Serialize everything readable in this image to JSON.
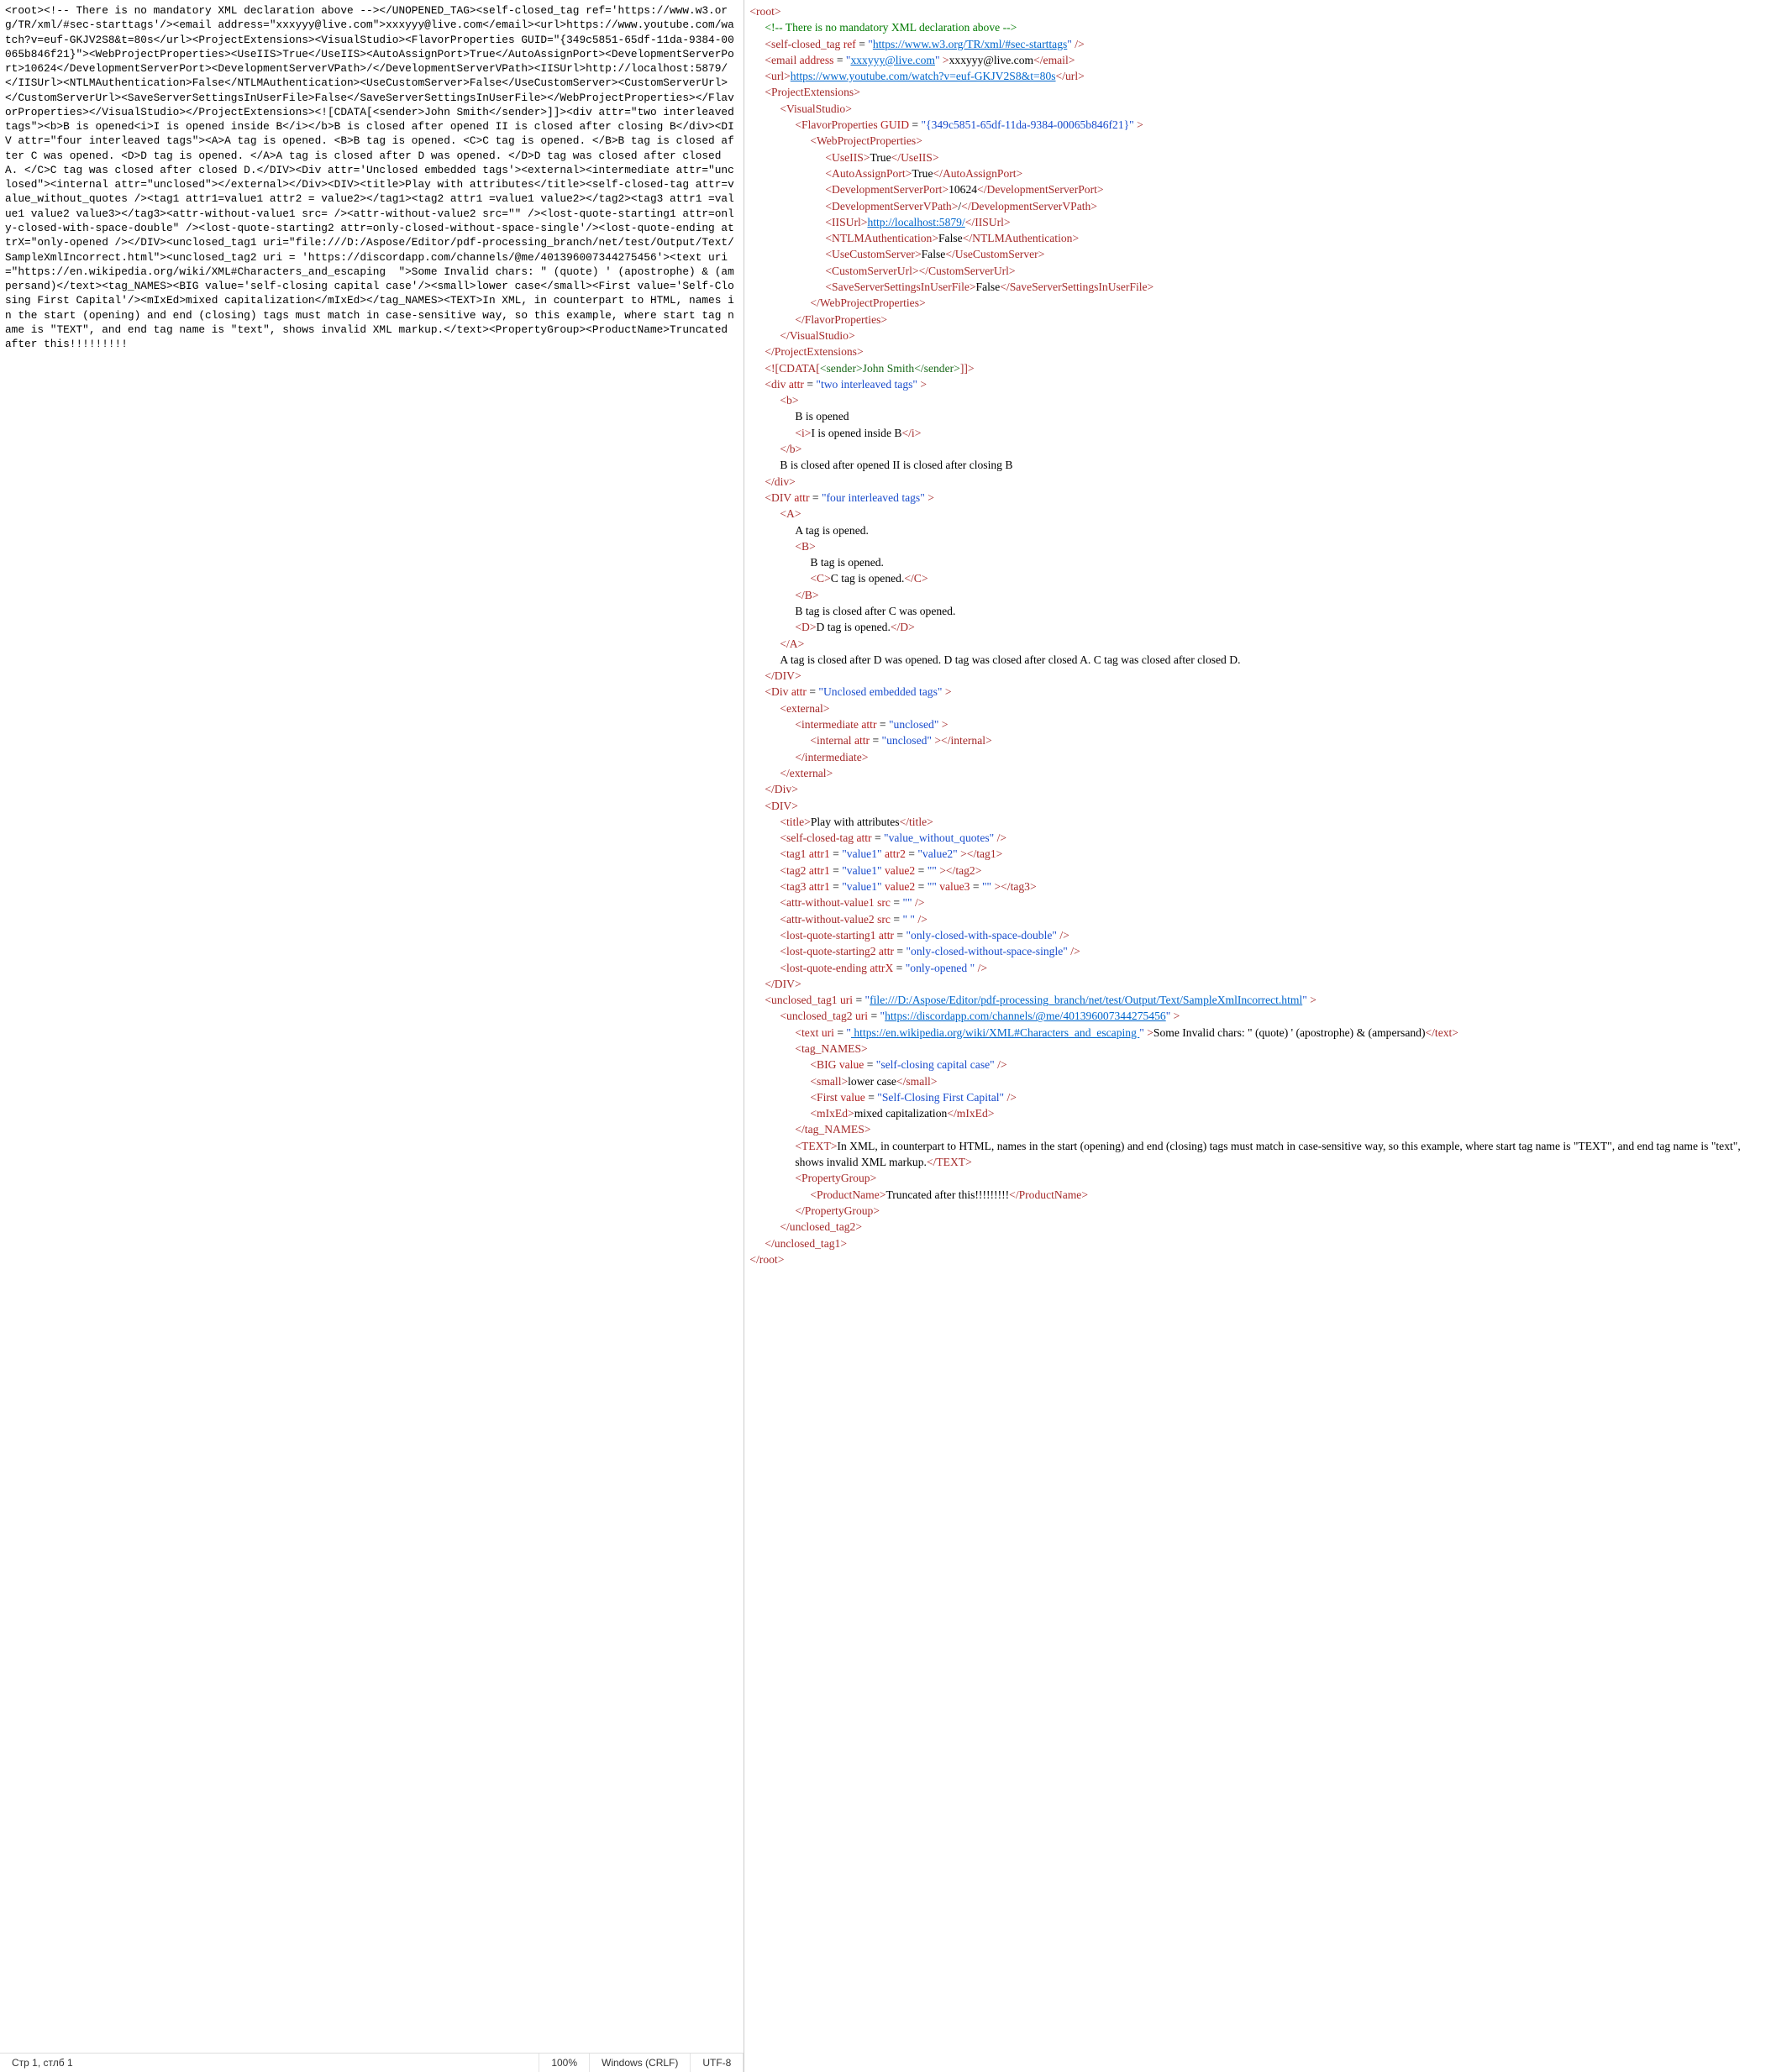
{
  "status": {
    "pos": "Стр 1, стлб 1",
    "zoom": "100%",
    "eol": "Windows (CRLF)",
    "encoding": "UTF-8"
  },
  "raw_left": "<root><!-- There is no mandatory XML declaration above --></UNOPENED_TAG><self-closed_tag ref='https://www.w3.org/TR/xml/#sec-starttags'/><email address=\"xxxyyy@live.com\">xxxyyy@live.com</email><url>https://www.youtube.com/watch?v=euf-GKJV2S8&t=80s</url><ProjectExtensions><VisualStudio><FlavorProperties GUID=\"{349c5851-65df-11da-9384-00065b846f21}\"><WebProjectProperties><UseIIS>True</UseIIS><AutoAssignPort>True</AutoAssignPort><DevelopmentServerPort>10624</DevelopmentServerPort><DevelopmentServerVPath>/</DevelopmentServerVPath><IISUrl>http://localhost:5879/</IISUrl><NTLMAuthentication>False</NTLMAuthentication><UseCustomServer>False</UseCustomServer><CustomServerUrl></CustomServerUrl><SaveServerSettingsInUserFile>False</SaveServerSettingsInUserFile></WebProjectProperties></FlavorProperties></VisualStudio></ProjectExtensions><![CDATA[<sender>John Smith</sender>]]><div attr=\"two interleaved tags\"><b>B is opened<i>I is opened inside B</i></b>B is closed after opened II is closed after closing B</div><DIV attr=\"four interleaved tags\"><A>A tag is opened. <B>B tag is opened. <C>C tag is opened. </B>B tag is closed after C was opened. <D>D tag is opened. </A>A tag is closed after D was opened. </D>D tag was closed after closed A. </C>C tag was closed after closed D.</DIV><Div attr='Unclosed embedded tags'><external><intermediate attr=\"unclosed\"><internal attr=\"unclosed\"></external></Div><DIV><title>Play with attributes</title><self-closed-tag attr=value_without_quotes /><tag1 attr1=value1 attr2 = value2></tag1><tag2 attr1 =value1 value2></tag2><tag3 attr1 =value1 value2 value3></tag3><attr-without-value1 src= /><attr-without-value2 src=\"\" /><lost-quote-starting1 attr=only-closed-with-space-double\" /><lost-quote-starting2 attr=only-closed-without-space-single'/><lost-quote-ending attrX=\"only-opened /></DIV><unclosed_tag1 uri=\"file:///D:/Aspose/Editor/pdf-processing_branch/net/test/Output/Text/SampleXmlIncorrect.html\"><unclosed_tag2 uri = 'https://discordapp.com/channels/@me/401396007344275456'><text uri=\"https://en.wikipedia.org/wiki/XML#Characters_and_escaping  \">Some Invalid chars: \" (quote) ' (apostrophe) & (ampersand)</text><tag_NAMES><BIG value='self-closing capital case'/><small>lower case</small><First value='Self-Closing First Capital'/><mIxEd>mixed capitalization</mIxEd></tag_NAMES><TEXT>In XML, in counterpart to HTML, names in the start (opening) and end (closing) tags must match in case-sensitive way, so this example, where start tag name is \"TEXT\", and end tag name is \"text\", shows invalid XML markup.</text><PropertyGroup><ProductName>Truncated after this!!!!!!!!!",
  "tree": [
    {
      "i": 0,
      "h": "<span class='t'>&lt;root&gt;</span>"
    },
    {
      "i": 1,
      "h": "<span class='cm'>&lt;!-- There is no mandatory XML declaration above --&gt;</span>"
    },
    {
      "i": 1,
      "h": "<span class='t'>&lt;self-closed_tag</span> <span class='an'>ref</span> = <span class='av'>\"<span class='lk'>https://www.w3.org/TR/xml/#sec-starttags</span>\"</span> <span class='t'>/&gt;</span>"
    },
    {
      "i": 1,
      "h": "<span class='t'>&lt;email</span> <span class='an'>address</span> = <span class='av'>\"<span class='lk'>xxxyyy@live.com</span>\"</span> <span class='t'>&gt;</span><span class='tx'>xxxyyy@live.com</span><span class='t'>&lt;/email&gt;</span>"
    },
    {
      "i": 1,
      "h": "<span class='t'>&lt;url&gt;</span><span class='lk'>https://www.youtube.com/watch?v=euf-GKJV2S8&amp;t=80s</span><span class='t'>&lt;/url&gt;</span>"
    },
    {
      "i": 1,
      "h": "<span class='t'>&lt;ProjectExtensions&gt;</span>"
    },
    {
      "i": 2,
      "h": "<span class='t'>&lt;VisualStudio&gt;</span>"
    },
    {
      "i": 3,
      "h": "<span class='t'>&lt;FlavorProperties</span> <span class='an'>GUID</span> = <span class='av'>\"{349c5851-65df-11da-9384-00065b846f21}\"</span> <span class='t'>&gt;</span>"
    },
    {
      "i": 4,
      "h": "<span class='t'>&lt;WebProjectProperties&gt;</span>"
    },
    {
      "i": 5,
      "h": "<span class='t'>&lt;UseIIS&gt;</span><span class='tx'>True</span><span class='t'>&lt;/UseIIS&gt;</span>"
    },
    {
      "i": 5,
      "h": "<span class='t'>&lt;AutoAssignPort&gt;</span><span class='tx'>True</span><span class='t'>&lt;/AutoAssignPort&gt;</span>"
    },
    {
      "i": 5,
      "h": "<span class='t'>&lt;DevelopmentServerPort&gt;</span><span class='tx'>10624</span><span class='t'>&lt;/DevelopmentServerPort&gt;</span>"
    },
    {
      "i": 5,
      "h": "<span class='t'>&lt;DevelopmentServerVPath&gt;</span><span class='tx'>/</span><span class='t'>&lt;/DevelopmentServerVPath&gt;</span>"
    },
    {
      "i": 5,
      "h": "<span class='t'>&lt;IISUrl&gt;</span><span class='lk'>http://localhost:5879/</span><span class='t'>&lt;/IISUrl&gt;</span>"
    },
    {
      "i": 5,
      "h": "<span class='t'>&lt;NTLMAuthentication&gt;</span><span class='tx'>False</span><span class='t'>&lt;/NTLMAuthentication&gt;</span>"
    },
    {
      "i": 5,
      "h": "<span class='t'>&lt;UseCustomServer&gt;</span><span class='tx'>False</span><span class='t'>&lt;/UseCustomServer&gt;</span>"
    },
    {
      "i": 5,
      "h": "<span class='t'>&lt;CustomServerUrl&gt;&lt;/CustomServerUrl&gt;</span>"
    },
    {
      "i": 5,
      "h": "<span class='t'>&lt;SaveServerSettingsInUserFile&gt;</span><span class='tx'>False</span><span class='t'>&lt;/SaveServerSettingsInUserFile&gt;</span>"
    },
    {
      "i": 4,
      "h": "<span class='t'>&lt;/WebProjectProperties&gt;</span>"
    },
    {
      "i": 3,
      "h": "<span class='t'>&lt;/FlavorProperties&gt;</span>"
    },
    {
      "i": 2,
      "h": "<span class='t'>&lt;/VisualStudio&gt;</span>"
    },
    {
      "i": 1,
      "h": "<span class='t'>&lt;/ProjectExtensions&gt;</span>"
    },
    {
      "i": 1,
      "h": "<span class='t'>&lt;![CDATA[</span><span class='cd'>&lt;sender&gt;John Smith&lt;/sender&gt;</span><span class='t'>]]&gt;</span>"
    },
    {
      "i": 1,
      "h": "<span class='t'>&lt;div</span> <span class='an'>attr</span> = <span class='av'>\"two interleaved tags\"</span> <span class='t'>&gt;</span>"
    },
    {
      "i": 2,
      "h": "<span class='t'>&lt;b&gt;</span>"
    },
    {
      "i": 3,
      "h": "<span class='tx'>B is opened</span>"
    },
    {
      "i": 3,
      "h": "<span class='t'>&lt;i&gt;</span><span class='tx'>I is opened inside B</span><span class='t'>&lt;/i&gt;</span>"
    },
    {
      "i": 2,
      "h": "<span class='t'>&lt;/b&gt;</span>"
    },
    {
      "i": 2,
      "h": "<span class='tx'>B is closed after opened II is closed after closing B</span>"
    },
    {
      "i": 1,
      "h": "<span class='t'>&lt;/div&gt;</span>"
    },
    {
      "i": 1,
      "h": "<span class='t'>&lt;DIV</span> <span class='an'>attr</span> = <span class='av'>\"four interleaved tags\"</span> <span class='t'>&gt;</span>"
    },
    {
      "i": 2,
      "h": "<span class='t'>&lt;A&gt;</span>"
    },
    {
      "i": 3,
      "h": "<span class='tx'>A tag is opened.</span>"
    },
    {
      "i": 3,
      "h": "<span class='t'>&lt;B&gt;</span>"
    },
    {
      "i": 4,
      "h": "<span class='tx'>B tag is opened.</span>"
    },
    {
      "i": 4,
      "h": "<span class='t'>&lt;C&gt;</span><span class='tx'>C tag is opened.</span><span class='t'>&lt;/C&gt;</span>"
    },
    {
      "i": 3,
      "h": "<span class='t'>&lt;/B&gt;</span>"
    },
    {
      "i": 3,
      "h": "<span class='tx'>B tag is closed after C was opened.</span>"
    },
    {
      "i": 3,
      "h": "<span class='t'>&lt;D&gt;</span><span class='tx'>D tag is opened.</span><span class='t'>&lt;/D&gt;</span>"
    },
    {
      "i": 2,
      "h": "<span class='t'>&lt;/A&gt;</span>"
    },
    {
      "i": 2,
      "h": "<span class='tx'>A tag is closed after D was opened. D tag was closed after closed A. C tag was closed after closed D.</span>"
    },
    {
      "i": 1,
      "h": "<span class='t'>&lt;/DIV&gt;</span>"
    },
    {
      "i": 1,
      "h": "<span class='t'>&lt;Div</span> <span class='an'>attr</span> = <span class='av'>\"Unclosed embedded tags\"</span> <span class='t'>&gt;</span>"
    },
    {
      "i": 2,
      "h": "<span class='t'>&lt;external&gt;</span>"
    },
    {
      "i": 3,
      "h": "<span class='t'>&lt;intermediate</span> <span class='an'>attr</span> = <span class='av'>\"unclosed\"</span> <span class='t'>&gt;</span>"
    },
    {
      "i": 4,
      "h": "<span class='t'>&lt;internal</span> <span class='an'>attr</span> = <span class='av'>\"unclosed\"</span> <span class='t'>&gt;&lt;/internal&gt;</span>"
    },
    {
      "i": 3,
      "h": "<span class='t'>&lt;/intermediate&gt;</span>"
    },
    {
      "i": 2,
      "h": "<span class='t'>&lt;/external&gt;</span>"
    },
    {
      "i": 1,
      "h": "<span class='t'>&lt;/Div&gt;</span>"
    },
    {
      "i": 1,
      "h": "<span class='t'>&lt;DIV&gt;</span>"
    },
    {
      "i": 2,
      "h": "<span class='t'>&lt;title&gt;</span><span class='tx'>Play with attributes</span><span class='t'>&lt;/title&gt;</span>"
    },
    {
      "i": 2,
      "h": "<span class='t'>&lt;self-closed-tag</span> <span class='an'>attr</span> = <span class='av'>\"value_without_quotes\"</span> <span class='t'>/&gt;</span>"
    },
    {
      "i": 2,
      "h": "<span class='t'>&lt;tag1</span> <span class='an'>attr1</span> = <span class='av'>\"value1\"</span> <span class='an'>attr2</span> = <span class='av'>\"value2\"</span> <span class='t'>&gt;&lt;/tag1&gt;</span>"
    },
    {
      "i": 2,
      "h": "<span class='t'>&lt;tag2</span> <span class='an'>attr1</span> = <span class='av'>\"value1\"</span> <span class='an'>value2</span> = <span class='av'>\"\"</span> <span class='t'>&gt;&lt;/tag2&gt;</span>"
    },
    {
      "i": 2,
      "h": "<span class='t'>&lt;tag3</span> <span class='an'>attr1</span> = <span class='av'>\"value1\"</span> <span class='an'>value2</span> = <span class='av'>\"\"</span> <span class='an'>value3</span> = <span class='av'>\"\"</span> <span class='t'>&gt;&lt;/tag3&gt;</span>"
    },
    {
      "i": 2,
      "h": "<span class='t'>&lt;attr-without-value1</span> <span class='an'>src</span> = <span class='av'>\"\"</span> <span class='t'>/&gt;</span>"
    },
    {
      "i": 2,
      "h": "<span class='t'>&lt;attr-without-value2</span> <span class='an'>src</span> = <span class='av'>\" \"</span> <span class='t'>/&gt;</span>"
    },
    {
      "i": 2,
      "h": "<span class='t'>&lt;lost-quote-starting1</span> <span class='an'>attr</span> = <span class='av'>\"only-closed-with-space-double\"</span> <span class='t'>/&gt;</span>"
    },
    {
      "i": 2,
      "h": "<span class='t'>&lt;lost-quote-starting2</span> <span class='an'>attr</span> = <span class='av'>\"only-closed-without-space-single\"</span> <span class='t'>/&gt;</span>"
    },
    {
      "i": 2,
      "h": "<span class='t'>&lt;lost-quote-ending</span> <span class='an'>attrX</span> = <span class='av'>\"only-opened \"</span> <span class='t'>/&gt;</span>"
    },
    {
      "i": 1,
      "h": "<span class='t'>&lt;/DIV&gt;</span>"
    },
    {
      "i": 1,
      "h": "<span class='t'>&lt;unclosed_tag1</span> <span class='an'>uri</span> = <span class='av'>\"<span class='lk'>file:///D:/Aspose/Editor/pdf-processing_branch/net/test/Output/Text/SampleXmlIncorrect.html</span>\"</span> <span class='t'>&gt;</span>"
    },
    {
      "i": 2,
      "h": "<span class='t'>&lt;unclosed_tag2</span> <span class='an'>uri</span> = <span class='av'>\"<span class='lk'>https://discordapp.com/channels/@me/401396007344275456</span>\"</span> <span class='t'>&gt;</span>"
    },
    {
      "i": 3,
      "h": "<span class='t'>&lt;text</span> <span class='an'>uri</span> = <span class='av'>\"<span class='lk'> https://en.wikipedia.org/wiki/XML#Characters_and_escaping </span>\"</span> <span class='t'>&gt;</span><span class='tx'>Some Invalid chars: \" (quote) ' (apostrophe) &amp; (ampersand)</span><span class='t'>&lt;/text&gt;</span>"
    },
    {
      "i": 3,
      "h": "<span class='t'>&lt;tag_NAMES&gt;</span>"
    },
    {
      "i": 4,
      "h": "<span class='t'>&lt;BIG</span> <span class='an'>value</span> = <span class='av'>\"self-closing capital case\"</span> <span class='t'>/&gt;</span>"
    },
    {
      "i": 4,
      "h": "<span class='t'>&lt;small&gt;</span><span class='tx'>lower case</span><span class='t'>&lt;/small&gt;</span>"
    },
    {
      "i": 4,
      "h": "<span class='t'>&lt;First</span> <span class='an'>value</span> = <span class='av'>\"Self-Closing First Capital\"</span> <span class='t'>/&gt;</span>"
    },
    {
      "i": 4,
      "h": "<span class='t'>&lt;mIxEd&gt;</span><span class='tx'>mixed capitalization</span><span class='t'>&lt;/mIxEd&gt;</span>"
    },
    {
      "i": 3,
      "h": "<span class='t'>&lt;/tag_NAMES&gt;</span>"
    },
    {
      "i": 3,
      "h": "<span class='t'>&lt;TEXT&gt;</span><span class='tx'>In XML, in counterpart to HTML, names in the start (opening) and end (closing) tags must match in case-sensitive way, so this example, where start tag name is \"TEXT\", and end tag name is \"text\", shows invalid XML markup.</span><span class='t'>&lt;/TEXT&gt;</span>"
    },
    {
      "i": 3,
      "h": "<span class='t'>&lt;PropertyGroup&gt;</span>"
    },
    {
      "i": 4,
      "h": "<span class='t'>&lt;ProductName&gt;</span><span class='tx'>Truncated after this!!!!!!!!!</span><span class='t'>&lt;/ProductName&gt;</span>"
    },
    {
      "i": 3,
      "h": "<span class='t'>&lt;/PropertyGroup&gt;</span>"
    },
    {
      "i": 2,
      "h": "<span class='t'>&lt;/unclosed_tag2&gt;</span>"
    },
    {
      "i": 1,
      "h": "<span class='t'>&lt;/unclosed_tag1&gt;</span>"
    },
    {
      "i": 0,
      "h": "<span class='t'>&lt;/root&gt;</span>"
    }
  ]
}
